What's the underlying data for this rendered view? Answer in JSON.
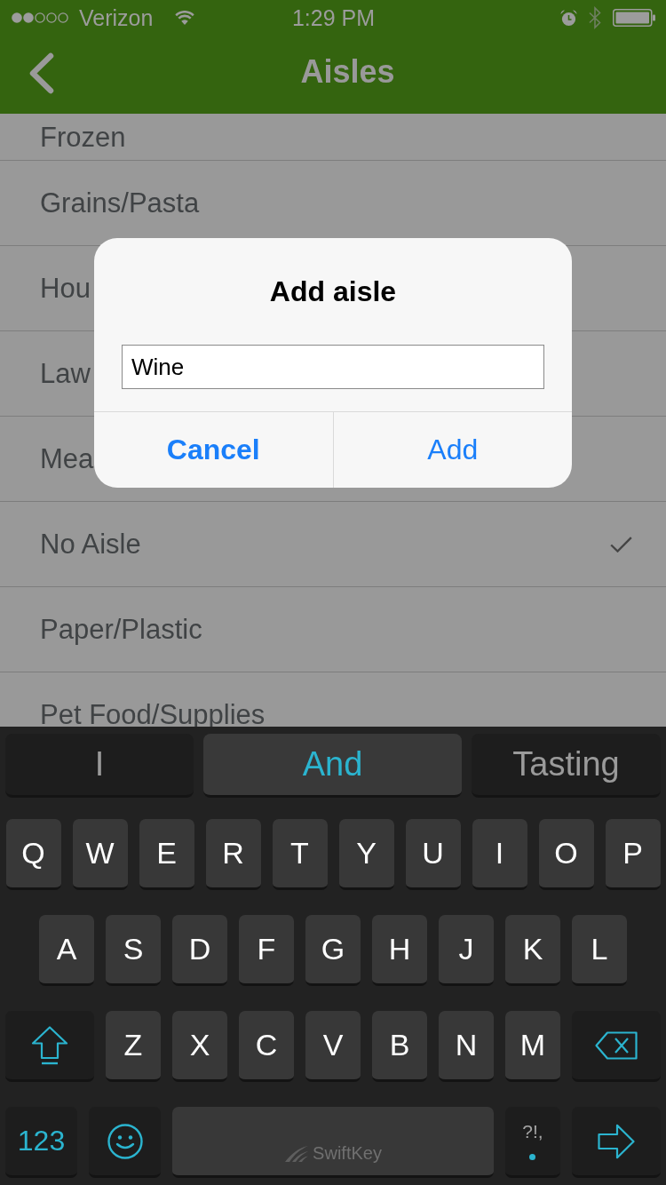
{
  "status_bar": {
    "carrier": "Verizon",
    "time": "1:29 PM"
  },
  "nav_bar": {
    "title": "Aisles"
  },
  "aisles": [
    {
      "label": "Frozen",
      "selected": false
    },
    {
      "label": "Grains/Pasta",
      "selected": false
    },
    {
      "label": "Hou",
      "selected": false
    },
    {
      "label": "Law",
      "selected": false
    },
    {
      "label": "Mea",
      "selected": false
    },
    {
      "label": "No Aisle",
      "selected": true
    },
    {
      "label": "Paper/Plastic",
      "selected": false
    },
    {
      "label": "Pet Food/Supplies",
      "selected": false
    }
  ],
  "dialog": {
    "title": "Add aisle",
    "input": {
      "value": "Wine"
    },
    "buttons": [
      {
        "label": "Cancel",
        "kind": "cancel"
      },
      {
        "label": "Add",
        "kind": "default"
      }
    ]
  },
  "keyboard": {
    "suggestions": [
      {
        "label": "I",
        "selected": false
      },
      {
        "label": "And",
        "selected": true
      },
      {
        "label": "Tasting",
        "selected": false
      }
    ],
    "top_letters": [
      {
        "kind": "letter",
        "label": "Q"
      },
      {
        "kind": "letter",
        "label": "W"
      },
      {
        "kind": "letter",
        "label": "E"
      },
      {
        "kind": "letter",
        "label": "R"
      },
      {
        "kind": "letter",
        "label": "T"
      },
      {
        "kind": "letter",
        "label": "Y"
      },
      {
        "kind": "letter",
        "label": "U"
      },
      {
        "kind": "letter",
        "label": "I"
      },
      {
        "kind": "letter",
        "label": "O"
      },
      {
        "kind": "letter",
        "label": "P"
      }
    ],
    "middle_letters": [
      {
        "kind": "letter",
        "label": "A"
      },
      {
        "kind": "letter",
        "label": "S"
      },
      {
        "kind": "letter",
        "label": "D"
      },
      {
        "kind": "letter",
        "label": "F"
      },
      {
        "kind": "letter",
        "label": "G"
      },
      {
        "kind": "letter",
        "label": "H"
      },
      {
        "kind": "letter",
        "label": "J"
      },
      {
        "kind": "letter",
        "label": "K"
      },
      {
        "kind": "letter",
        "label": "L"
      }
    ],
    "bottom_letters": [
      {
        "kind": "shift"
      },
      {
        "kind": "letter",
        "label": "Z"
      },
      {
        "kind": "letter",
        "label": "X"
      },
      {
        "kind": "letter",
        "label": "C"
      },
      {
        "kind": "letter",
        "label": "V"
      },
      {
        "kind": "letter",
        "label": "B"
      },
      {
        "kind": "letter",
        "label": "N"
      },
      {
        "kind": "letter",
        "label": "M"
      },
      {
        "kind": "backspace"
      }
    ],
    "function_keys": [
      {
        "kind": "numbers",
        "label": "123"
      },
      {
        "kind": "emoji"
      },
      {
        "kind": "space",
        "label": "SwiftKey"
      },
      {
        "kind": "punctuation",
        "label": "?!,"
      },
      {
        "kind": "return"
      }
    ]
  }
}
